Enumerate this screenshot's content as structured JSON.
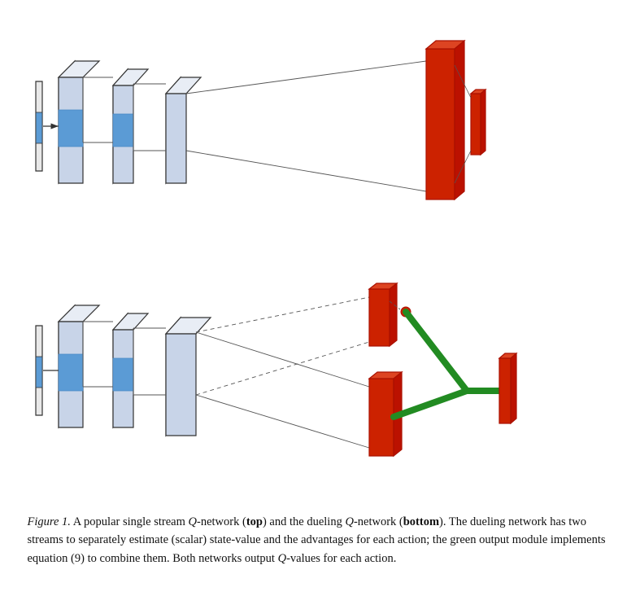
{
  "caption": {
    "figure_label": "Figure 1.",
    "text_parts": [
      " A popular single stream ",
      "Q",
      "-network (",
      "top",
      ") and the dueling ",
      "Q",
      "-network (",
      "bottom",
      ").  The dueling network has two streams to separately estimate (scalar) state-value and the advantages for each action; the green output module implements equation (9) to combine them. Both networks output ",
      "Q",
      "-values for each action."
    ]
  }
}
